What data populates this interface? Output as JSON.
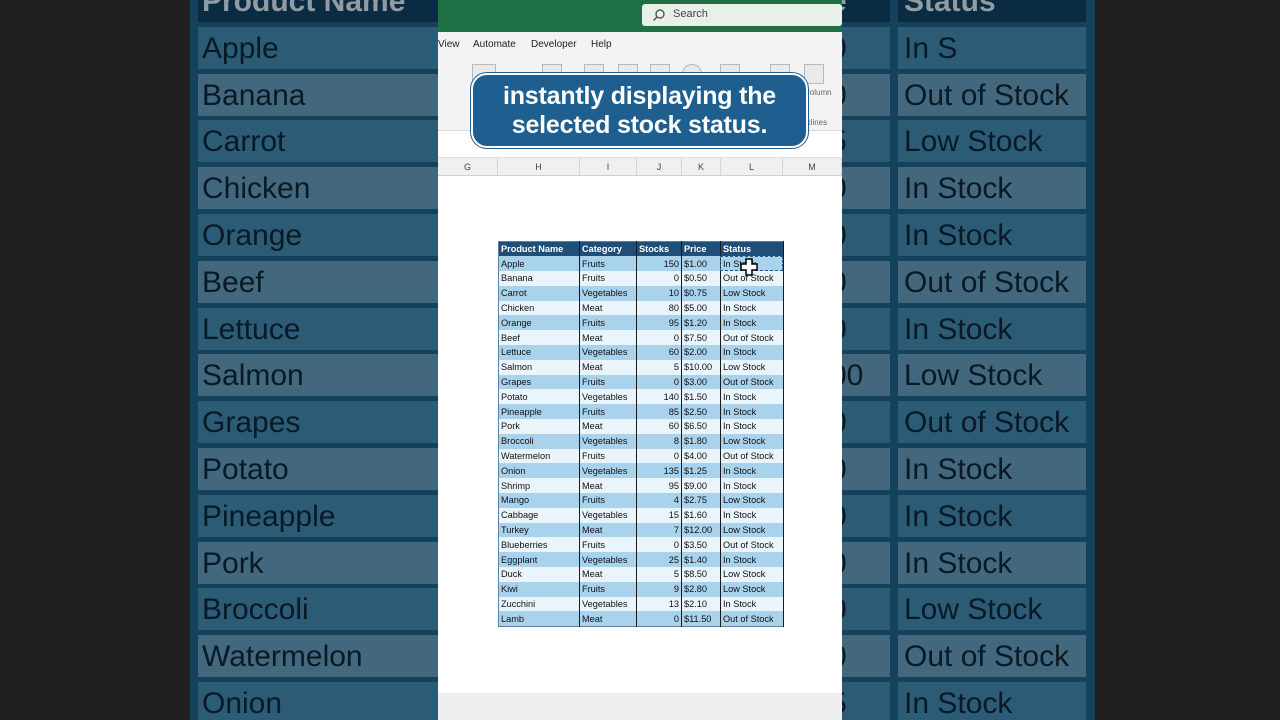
{
  "caption": {
    "line1": "instantly displaying the",
    "line2": "selected stock status."
  },
  "search": {
    "placeholder": "Search"
  },
  "menu": [
    "View",
    "Automate",
    "Developer",
    "Help"
  ],
  "ribbon_labels": [
    "Column",
    "rklines"
  ],
  "columns": [
    "G",
    "H",
    "I",
    "J",
    "K",
    "L",
    "M"
  ],
  "table": {
    "headers": [
      "Product Name",
      "Category",
      "Stocks",
      "Price",
      "Status"
    ],
    "rows": [
      [
        "Apple",
        "Fruits",
        "150",
        "$1.00",
        "In Stock"
      ],
      [
        "Banana",
        "Fruits",
        "0",
        "$0.50",
        "Out of Stock"
      ],
      [
        "Carrot",
        "Vegetables",
        "10",
        "$0.75",
        "Low Stock"
      ],
      [
        "Chicken",
        "Meat",
        "80",
        "$5.00",
        "In Stock"
      ],
      [
        "Orange",
        "Fruits",
        "95",
        "$1.20",
        "In Stock"
      ],
      [
        "Beef",
        "Meat",
        "0",
        "$7.50",
        "Out of Stock"
      ],
      [
        "Lettuce",
        "Vegetables",
        "60",
        "$2.00",
        "In Stock"
      ],
      [
        "Salmon",
        "Meat",
        "5",
        "$10.00",
        "Low Stock"
      ],
      [
        "Grapes",
        "Fruits",
        "0",
        "$3.00",
        "Out of Stock"
      ],
      [
        "Potato",
        "Vegetables",
        "140",
        "$1.50",
        "In Stock"
      ],
      [
        "Pineapple",
        "Fruits",
        "85",
        "$2.50",
        "In Stock"
      ],
      [
        "Pork",
        "Meat",
        "60",
        "$6.50",
        "In Stock"
      ],
      [
        "Broccoli",
        "Vegetables",
        "8",
        "$1.80",
        "Low Stock"
      ],
      [
        "Watermelon",
        "Fruits",
        "0",
        "$4.00",
        "Out of Stock"
      ],
      [
        "Onion",
        "Vegetables",
        "135",
        "$1.25",
        "In Stock"
      ],
      [
        "Shrimp",
        "Meat",
        "95",
        "$9.00",
        "In Stock"
      ],
      [
        "Mango",
        "Fruits",
        "4",
        "$2.75",
        "Low Stock"
      ],
      [
        "Cabbage",
        "Vegetables",
        "15",
        "$1.60",
        "In Stock"
      ],
      [
        "Turkey",
        "Meat",
        "7",
        "$12.00",
        "Low Stock"
      ],
      [
        "Blueberries",
        "Fruits",
        "0",
        "$3.50",
        "Out of Stock"
      ],
      [
        "Eggplant",
        "Vegetables",
        "25",
        "$1.40",
        "In Stock"
      ],
      [
        "Duck",
        "Meat",
        "5",
        "$8.50",
        "Low Stock"
      ],
      [
        "Kiwi",
        "Fruits",
        "9",
        "$2.80",
        "Low Stock"
      ],
      [
        "Zucchini",
        "Vegetables",
        "13",
        "$2.10",
        "In Stock"
      ],
      [
        "Lamb",
        "Meat",
        "0",
        "$11.50",
        "Out of Stock"
      ]
    ]
  },
  "background": {
    "header_left": "Product Name",
    "header_right": "Status",
    "header_mid": "e",
    "rows": [
      [
        "Apple",
        "0",
        "In S"
      ],
      [
        "Banana",
        "0",
        "Out of Stock"
      ],
      [
        "Carrot",
        "5",
        "Low Stock"
      ],
      [
        "Chicken",
        "0",
        "In Stock"
      ],
      [
        "Orange",
        "0",
        "In Stock"
      ],
      [
        "Beef",
        "0",
        "Out of Stock"
      ],
      [
        "Lettuce",
        "0",
        "In Stock"
      ],
      [
        "Salmon",
        "00",
        "Low Stock"
      ],
      [
        "Grapes",
        "0",
        "Out of Stock"
      ],
      [
        "Potato",
        "0",
        "In Stock"
      ],
      [
        "Pineapple",
        "0",
        "In Stock"
      ],
      [
        "Pork",
        "0",
        "In Stock"
      ],
      [
        "Broccoli",
        "0",
        "Low Stock"
      ],
      [
        "Watermelon",
        "0",
        "Out of Stock"
      ],
      [
        "Onion",
        "5",
        "In Stock"
      ]
    ]
  },
  "colors": {
    "excel_green": "#1e7145",
    "header_blue": "#1f4e78",
    "row_blue": "#a9d2ed",
    "row_light": "#eaf5fb",
    "caption_bg": "#1f5f8f"
  }
}
